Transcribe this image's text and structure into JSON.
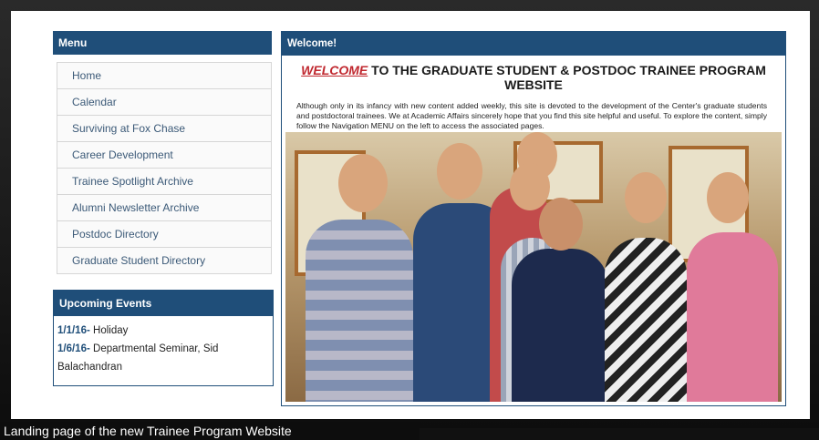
{
  "menu": {
    "title": "Menu",
    "items": [
      {
        "label": "Home"
      },
      {
        "label": "Calendar"
      },
      {
        "label": "Surviving at Fox Chase"
      },
      {
        "label": "Career Development"
      },
      {
        "label": "Trainee Spotlight Archive"
      },
      {
        "label": "Alumni Newsletter Archive"
      },
      {
        "label": "Postdoc Directory"
      },
      {
        "label": "Graduate Student Directory"
      }
    ]
  },
  "events": {
    "title": "Upcoming Events",
    "items": [
      {
        "date": "1/1/16-",
        "text": "Holiday"
      },
      {
        "date": "1/6/16-",
        "text": "Departmental Seminar, Sid Balachandran"
      }
    ]
  },
  "welcome": {
    "header": "Welcome!",
    "title_accent": "WELCOME",
    "title_rest": "TO THE GRADUATE STUDENT & POSTDOC TRAINEE PROGRAM WEBSITE",
    "body": "Although only in its infancy with new content added weekly, this site is devoted to the development of the Center's graduate students and postdoctoral trainees. We at Academic Affairs sincerely hope that you find this site helpful and useful. To explore the content, simply follow the Navigation MENU on the left to access the associated pages."
  },
  "caption": "Landing page of the new Trainee Program Website",
  "colors": {
    "header_blue": "#1f4e79",
    "accent_red": "#c0282f",
    "link_blue": "#3c5a78"
  }
}
